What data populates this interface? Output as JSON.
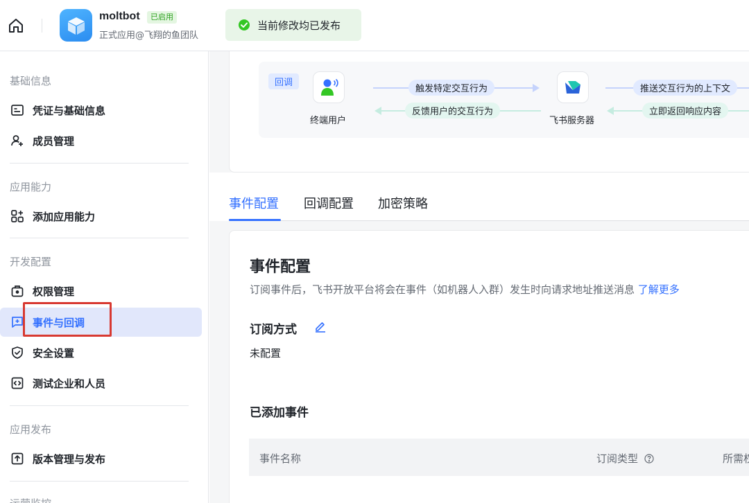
{
  "header": {
    "app_name": "moltbot",
    "app_status": "已启用",
    "app_subtitle": "正式应用@飞翔的鱼团队",
    "toast": "当前修改均已发布"
  },
  "sidebar": {
    "sections": [
      {
        "title": "基础信息",
        "items": [
          "凭证与基础信息",
          "成员管理"
        ]
      },
      {
        "title": "应用能力",
        "items": [
          "添加应用能力"
        ]
      },
      {
        "title": "开发配置",
        "items": [
          "权限管理",
          "事件与回调",
          "安全设置",
          "测试企业和人员"
        ]
      },
      {
        "title": "应用发布",
        "items": [
          "版本管理与发布"
        ]
      },
      {
        "title": "运营监控"
      }
    ]
  },
  "flow": {
    "tag": "回调",
    "node_user": "终端用户",
    "node_server": "飞书服务器",
    "arrow_trigger": "触发特定交互行为",
    "arrow_feedback": "反馈用户的交互行为",
    "arrow_push": "推送交互行为的上下文",
    "arrow_return": "立即返回响应内容"
  },
  "tabs": [
    "事件配置",
    "回调配置",
    "加密策略"
  ],
  "content": {
    "title": "事件配置",
    "desc": "订阅事件后，飞书开放平台将会在事件（如机器人入群）发生时向请求地址推送消息",
    "desc_link": "了解更多",
    "sub_mode_title": "订阅方式",
    "sub_mode_value": "未配置",
    "added_title": "已添加事件",
    "table_headers": [
      "事件名称",
      "订阅类型",
      "所需权"
    ]
  },
  "colors": {
    "accent": "#3370ff",
    "active_bg": "#e1e7fb",
    "highlight": "#d83931",
    "success": "#2ea121"
  }
}
